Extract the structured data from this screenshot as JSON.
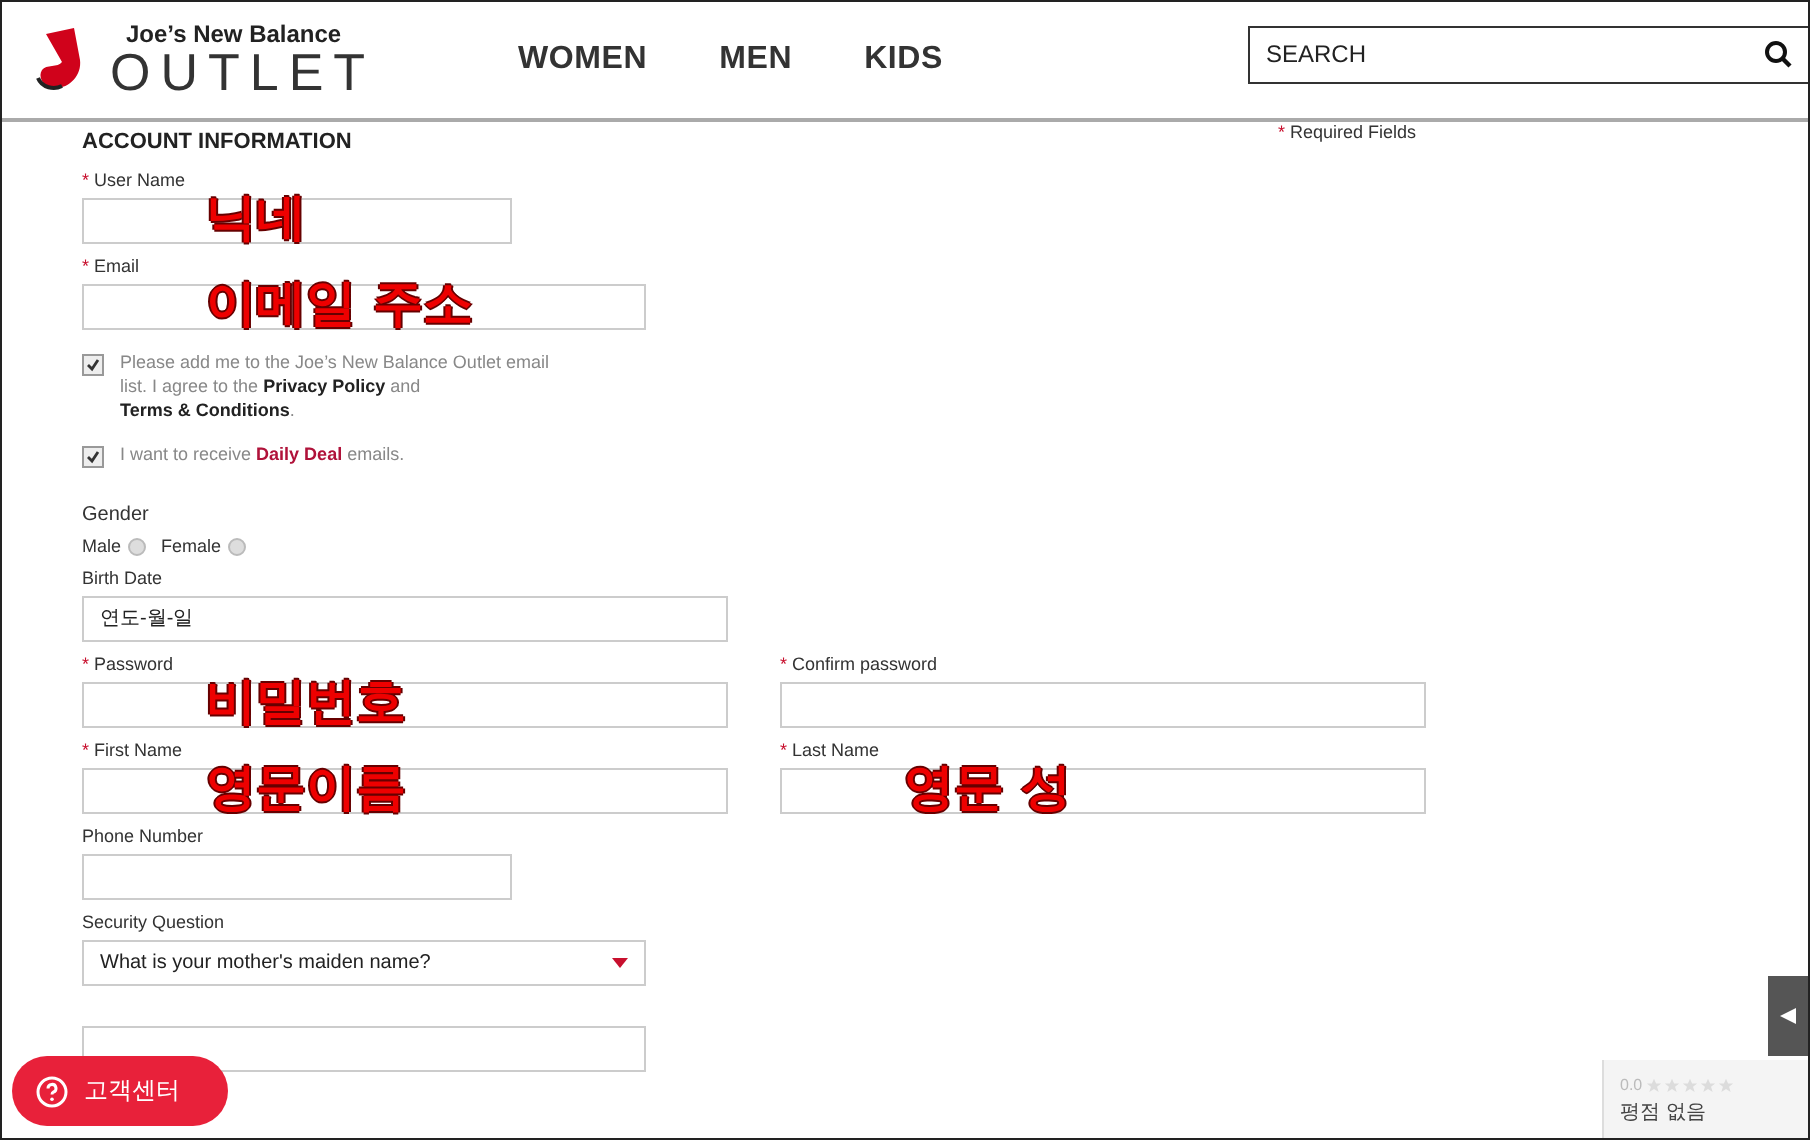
{
  "header": {
    "logo": {
      "line1": "Joe’s New Balance",
      "line2": "OUTLET"
    },
    "nav": [
      "WOMEN",
      "MEN",
      "KIDS"
    ],
    "search": {
      "placeholder": "SEARCH"
    }
  },
  "form": {
    "title": "ACCOUNT INFORMATION",
    "required_note": {
      "mark": "*",
      "text": "Required Fields"
    },
    "rows": [
      {
        "fields": [
          {
            "kind": "text",
            "label": "User Name",
            "required": true,
            "annotation": "닉네"
          }
        ]
      },
      {
        "fields": [
          {
            "kind": "text",
            "label": "Email",
            "required": true,
            "annotation": "이메일 주소"
          }
        ]
      },
      {
        "fields": [
          {
            "kind": "checkbox",
            "checked": true,
            "parts": [
              {
                "kind": "plain",
                "text": "Please add me to the Joe’s New Balance Outlet email list. I agree to the"
              },
              {
                "kind": "bold",
                "text": "Privacy Policy"
              },
              {
                "kind": "plain",
                "text": "and"
              },
              {
                "kind": "bold",
                "text": "Terms & Conditions"
              },
              {
                "kind": "plain",
                "text": "."
              }
            ]
          }
        ]
      },
      {
        "fields": [
          {
            "kind": "checkbox",
            "checked": true,
            "parts": [
              {
                "kind": "plain",
                "text": "I want to receive"
              },
              {
                "kind": "link",
                "text": "Daily Deal"
              },
              {
                "kind": "plain",
                "text": "emails."
              }
            ]
          }
        ]
      },
      {
        "fields": [
          {
            "kind": "radio",
            "label": "Gender",
            "options": [
              {
                "label": "Male",
                "selected": false
              },
              {
                "label": "Female",
                "selected": false
              }
            ]
          }
        ]
      },
      {
        "fields": [
          {
            "kind": "text",
            "label": "Birth Date",
            "required": false,
            "placeholder": "연도-월-일"
          }
        ]
      },
      {
        "fields": [
          {
            "kind": "text",
            "label": "Password",
            "required": true,
            "annotation": "비밀번호"
          },
          {
            "kind": "text",
            "label": "Confirm password",
            "required": true
          }
        ]
      },
      {
        "fields": [
          {
            "kind": "text",
            "label": "First Name",
            "required": true,
            "annotation": "영문이름"
          },
          {
            "kind": "text",
            "label": "Last Name",
            "required": true,
            "annotation": "영문 성"
          }
        ]
      },
      {
        "fields": [
          {
            "kind": "text",
            "label": "Phone Number",
            "required": false
          }
        ]
      },
      {
        "fields": [
          {
            "kind": "select",
            "label": "Security Question",
            "required": false,
            "value": "What is your mother's maiden name?"
          }
        ]
      },
      {
        "fields": [
          {
            "kind": "text"
          }
        ]
      }
    ]
  },
  "help_button": {
    "label": "고객센터"
  },
  "rating": {
    "score": "0.0",
    "stars": 0,
    "text": "평점 없음"
  }
}
